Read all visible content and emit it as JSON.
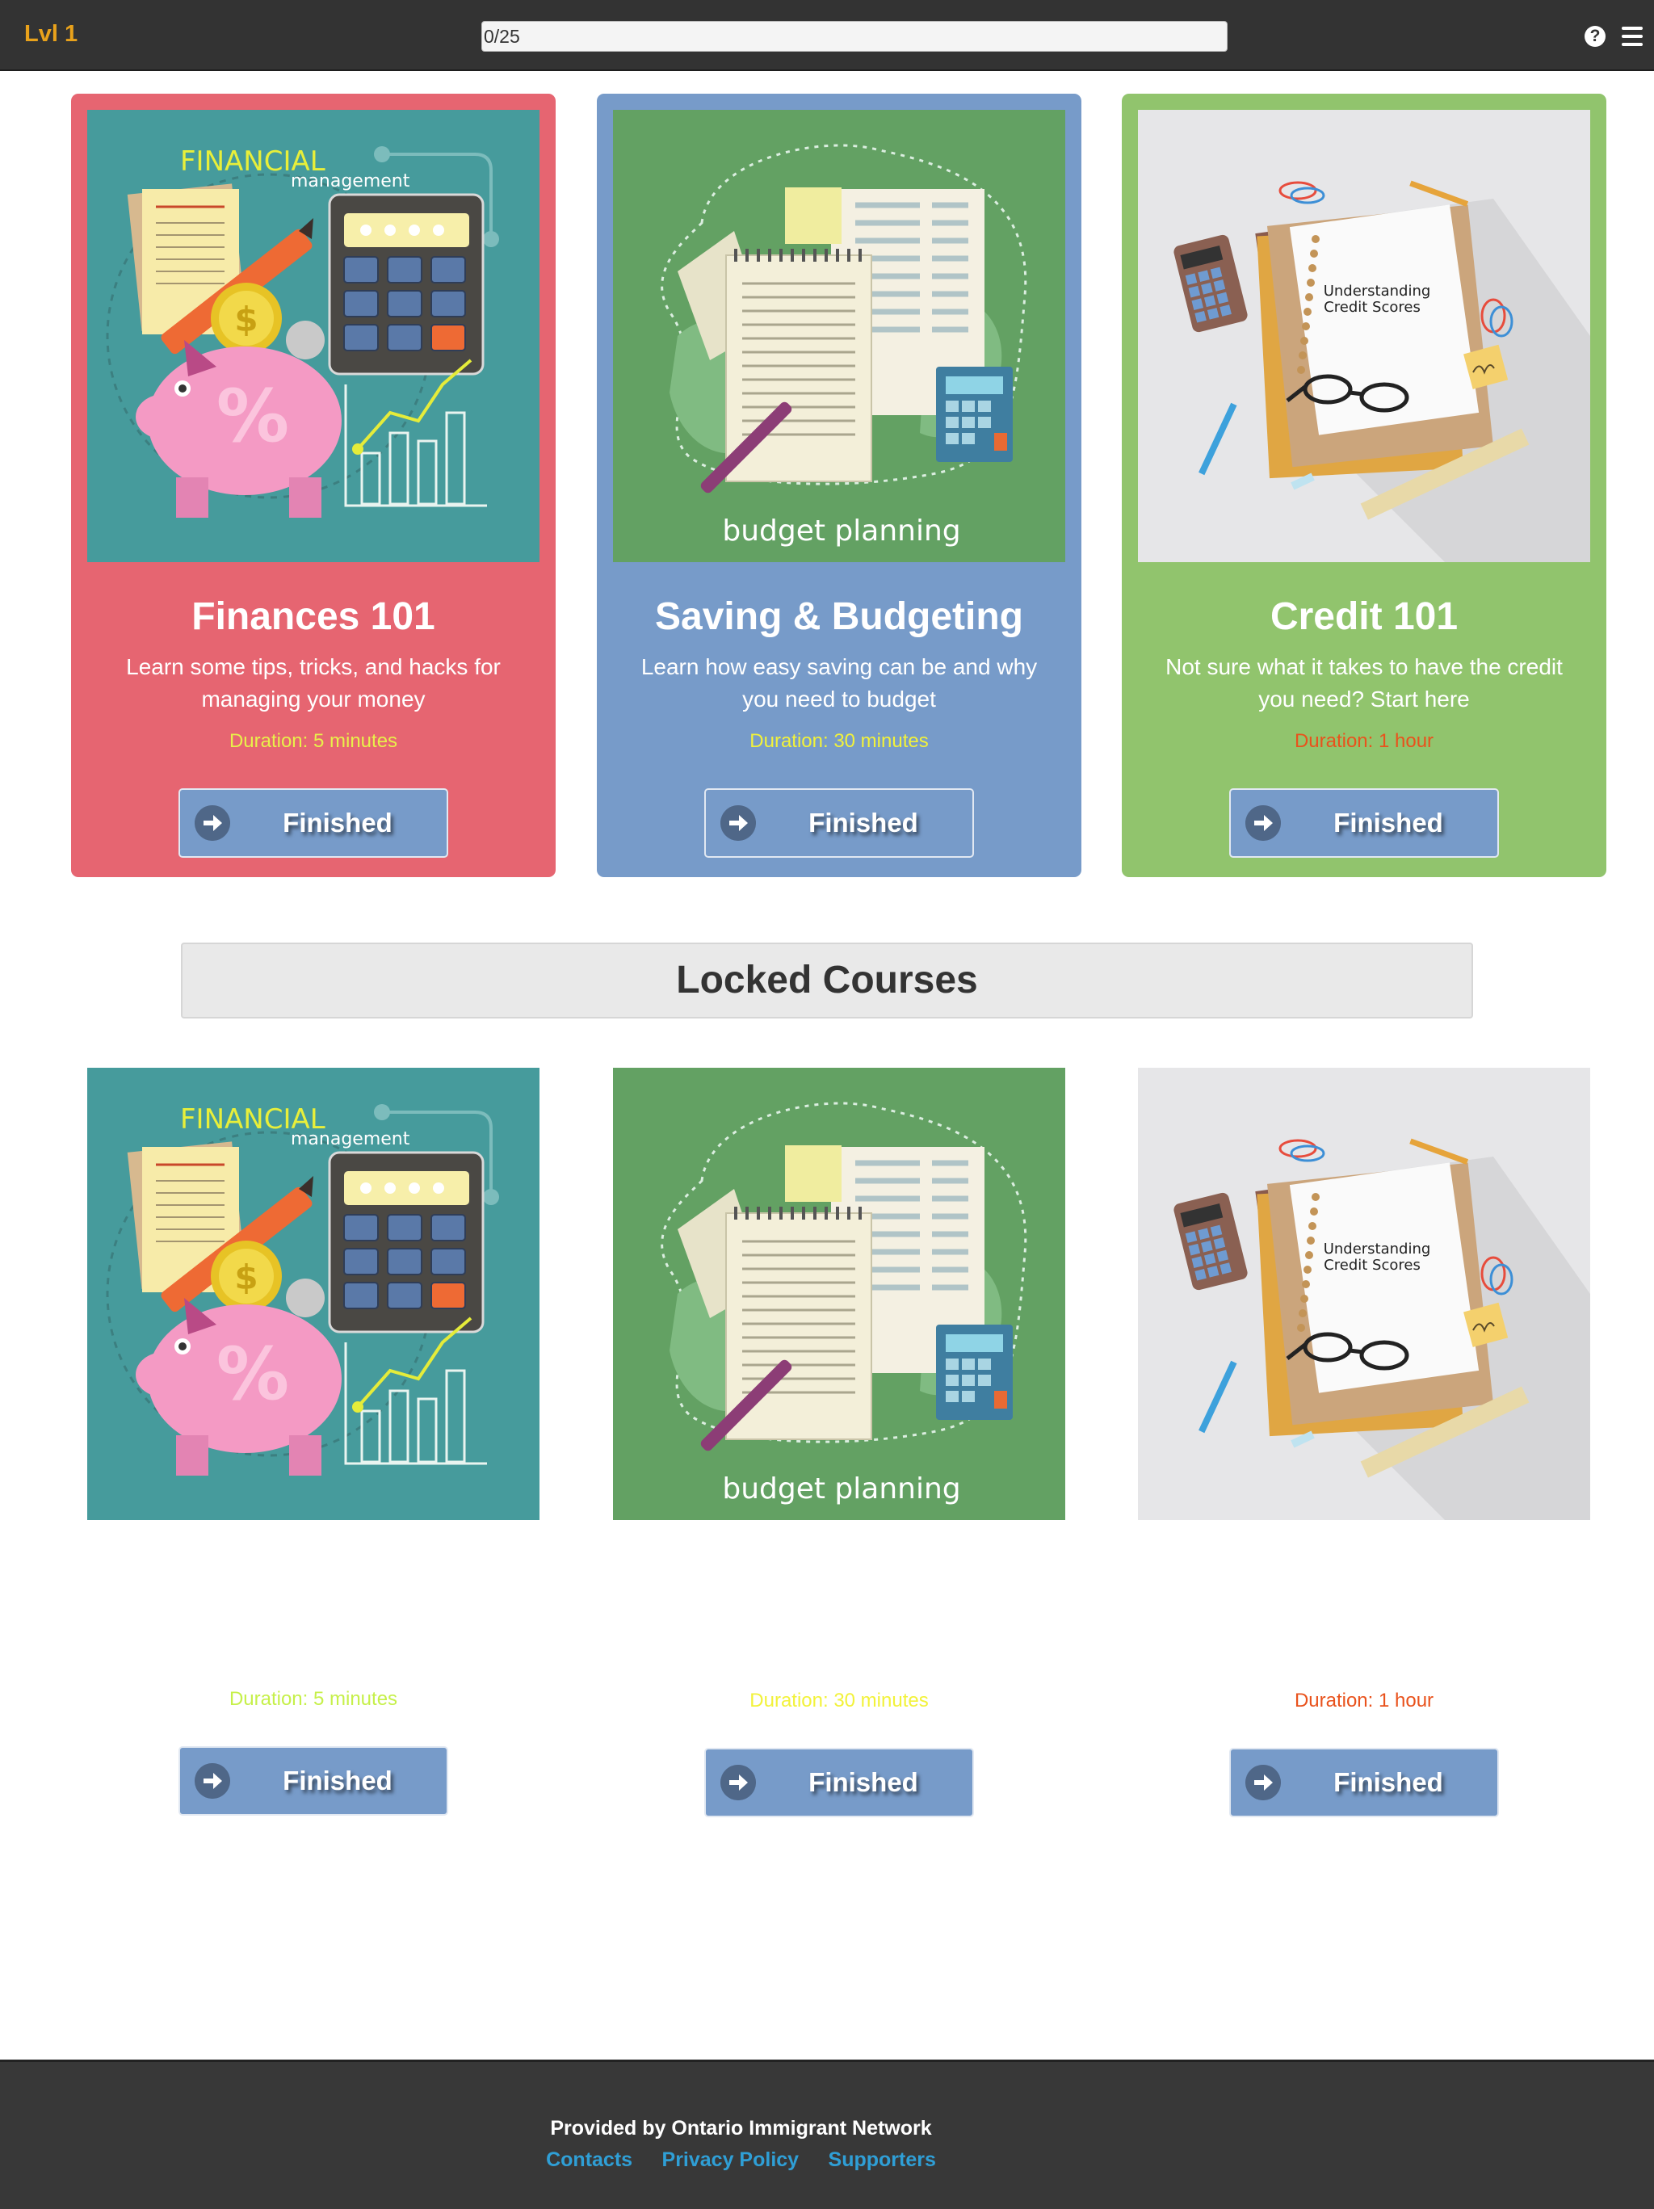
{
  "header": {
    "level": "Lvl 1",
    "progress_text": "0/25",
    "progress_fraction": 0,
    "help_icon": "question-circle-icon",
    "menu_icon": "hamburger-menu-icon"
  },
  "courses": [
    {
      "image_text": [
        "FINANCIAL",
        "management"
      ],
      "title": "Finances 101",
      "description": "Learn some tips, tricks, and hacks for managing your money",
      "duration": "Duration: 5 minutes",
      "duration_color": "#e8f04a",
      "button": "Finished",
      "card_color": "#e66571"
    },
    {
      "image_text": [
        "budget planning"
      ],
      "title": "Saving & Budgeting",
      "description": "Learn how easy saving can be and why you need to budget",
      "duration": "Duration: 30 minutes",
      "duration_color": "#f2f23a",
      "button": "Finished",
      "card_color": "#779bc9"
    },
    {
      "image_text": [
        "Understanding",
        "Credit Scores"
      ],
      "title": "Credit 101",
      "description": "Not sure what it takes to have the credit you need? Start here",
      "duration": "Duration: 1 hour",
      "duration_color": "#e9521c",
      "button": "Finished",
      "card_color": "#91c46d"
    }
  ],
  "locked": {
    "heading": "Locked Courses",
    "courses": [
      {
        "image_text": [
          "FINANCIAL",
          "management"
        ],
        "duration": "Duration: 5 minutes",
        "duration_color": "#c6f04a",
        "button": "Finished"
      },
      {
        "image_text": [
          "budget planning"
        ],
        "duration": "Duration: 30 minutes",
        "duration_color": "#f2f23a",
        "button": "Finished"
      },
      {
        "image_text": [
          "Understanding",
          "Credit Scores"
        ],
        "duration": "Duration: 1 hour",
        "duration_color": "#e9521c",
        "button": "Finished"
      }
    ]
  },
  "footer": {
    "provided_by": "Provided by Ontario Immigrant Network",
    "links": [
      "Contacts",
      "Privacy Policy",
      "Supporters"
    ]
  }
}
